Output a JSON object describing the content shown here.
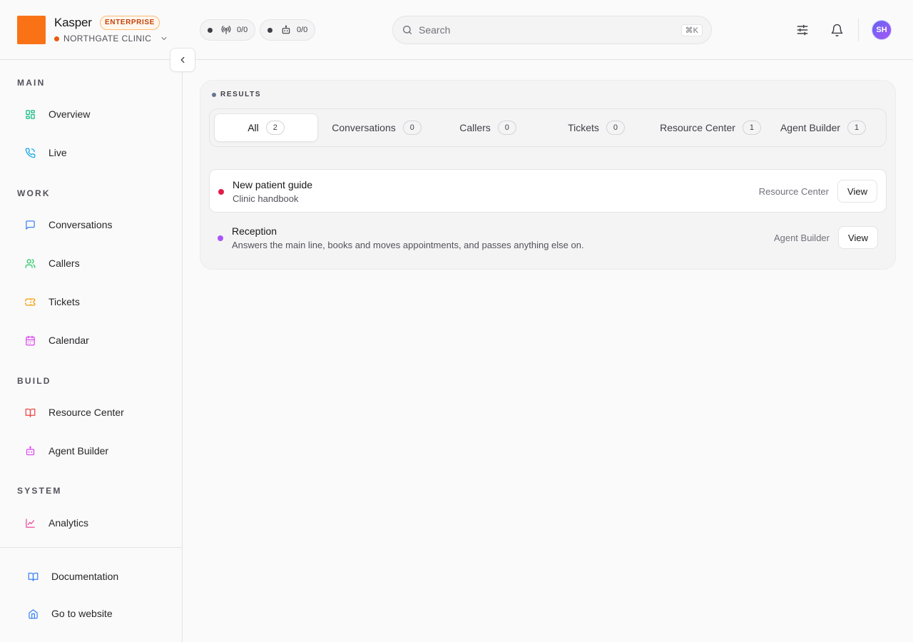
{
  "brand": {
    "name": "Kasper",
    "plan_badge": "ENTERPRISE",
    "org_name": "NORTHGATE CLINIC"
  },
  "status": [
    {
      "icon": "broadcast-icon",
      "value": "0/0"
    },
    {
      "icon": "bot-icon",
      "value": "0/0"
    }
  ],
  "search": {
    "placeholder": "Search",
    "shortcut": "⌘K"
  },
  "header": {
    "avatar_initials": "SH"
  },
  "sidebar": {
    "sections": [
      {
        "label": "MAIN",
        "items": [
          {
            "label": "Overview",
            "icon": "dashboard-icon",
            "color": "#10b981"
          },
          {
            "label": "Live",
            "icon": "phone-icon",
            "color": "#0ea5e9"
          }
        ]
      },
      {
        "label": "WORK",
        "items": [
          {
            "label": "Conversations",
            "icon": "message-icon",
            "color": "#3b82f6"
          },
          {
            "label": "Callers",
            "icon": "users-icon",
            "color": "#22c55e"
          },
          {
            "label": "Tickets",
            "icon": "ticket-icon",
            "color": "#f59e0b"
          },
          {
            "label": "Calendar",
            "icon": "calendar-icon",
            "color": "#d946ef"
          }
        ]
      },
      {
        "label": "BUILD",
        "items": [
          {
            "label": "Resource Center",
            "icon": "book-icon",
            "color": "#ef4444"
          },
          {
            "label": "Agent Builder",
            "icon": "bot-icon",
            "color": "#d946ef"
          }
        ]
      },
      {
        "label": "SYSTEM",
        "items": [
          {
            "label": "Analytics",
            "icon": "chart-icon",
            "color": "#ec4899"
          }
        ]
      }
    ],
    "footer": [
      {
        "label": "Documentation",
        "icon": "book-open-icon",
        "color": "#3b82f6"
      },
      {
        "label": "Go to website",
        "icon": "home-icon",
        "color": "#3b82f6"
      }
    ]
  },
  "results": {
    "heading": "RESULTS",
    "tabs": [
      {
        "label": "All",
        "count": "2",
        "active": true
      },
      {
        "label": "Conversations",
        "count": "0"
      },
      {
        "label": "Callers",
        "count": "0"
      },
      {
        "label": "Tickets",
        "count": "0"
      },
      {
        "label": "Resource Center",
        "count": "1"
      },
      {
        "label": "Agent Builder",
        "count": "1"
      }
    ],
    "items": [
      {
        "title": "New patient guide",
        "subtitle": "Clinic handbook",
        "source": "Resource Center",
        "dot_color": "#e11d48",
        "action": "View"
      },
      {
        "title": "Reception",
        "subtitle": "Answers the main line, books and moves appointments, and passes anything else on.",
        "source": "Agent Builder",
        "dot_color": "#a855f7",
        "action": "View"
      }
    ]
  },
  "colors": {
    "brand": "#f97316",
    "status_dot": "#ea580c"
  }
}
